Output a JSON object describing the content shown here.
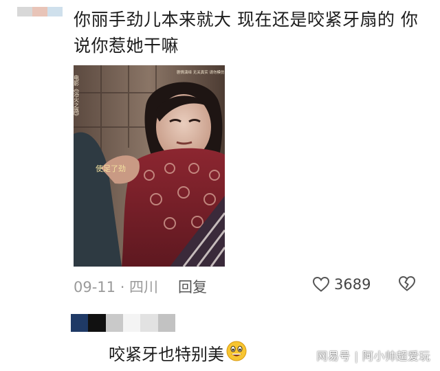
{
  "comment": {
    "text": "你丽手劲儿本来就大 现在还是咬紧牙扇的 你说你惹她干嘛",
    "username_blocks": [
      "#d8d8d8",
      "#e8c4b8",
      "#cfe0ec"
    ],
    "photo": {
      "overlay_title": "电影《浴火之路》",
      "overlay_corner": "剧情演绎 无关真实 请勿模仿",
      "subtitle": "使足了劲"
    },
    "date_location": "09-11 · 四川",
    "reply_label": "回复",
    "like_icon": "heart-outline-icon",
    "like_count": "3689",
    "dislike_icon": "broken-heart-icon"
  },
  "reply": {
    "username_blocks": [
      "#1f3a66",
      "#111111",
      "#c9c9c9",
      "#f4f4f4",
      "#e2e2e2",
      "#c2c2c2"
    ],
    "text": "咬紧牙也特别美",
    "emoji_icon": "grinning-face-icon"
  },
  "watermark": "网易号 | 阿小帅超爱玩"
}
